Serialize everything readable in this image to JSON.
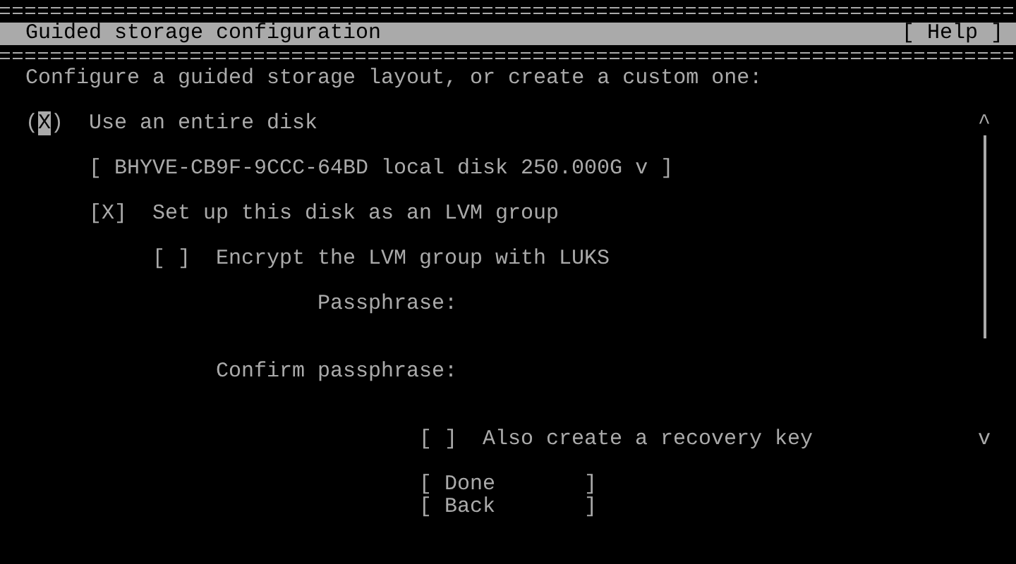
{
  "header": {
    "title": "Guided storage configuration",
    "help_button": "[ Help ]"
  },
  "intro": "Configure a guided storage layout, or create a custom one:",
  "disk_option": {
    "indicator": "(X)",
    "label": "Use an entire disk",
    "focused": true
  },
  "disk_select": {
    "value": "[ BHYVE-CB9F-9CCC-64BD local disk 250.000G v ]"
  },
  "lvm_option": {
    "indicator": "[X]",
    "label": "Set up this disk as an LVM group",
    "focused": false
  },
  "encrypt_option": {
    "indicator": "[ ]",
    "label": "Encrypt the LVM group with LUKS",
    "focused": false
  },
  "passphrase_label": "Passphrase:",
  "confirm_label": "Confirm passphrase:",
  "recovery_option": {
    "indicator": "[ ]",
    "label": "Also create a recovery key",
    "focused": false
  },
  "scrollbar": {
    "up": "^",
    "down": "v"
  },
  "buttons": [
    {
      "label": "[ Done       ]"
    },
    {
      "label": "[ Back       ]"
    }
  ]
}
